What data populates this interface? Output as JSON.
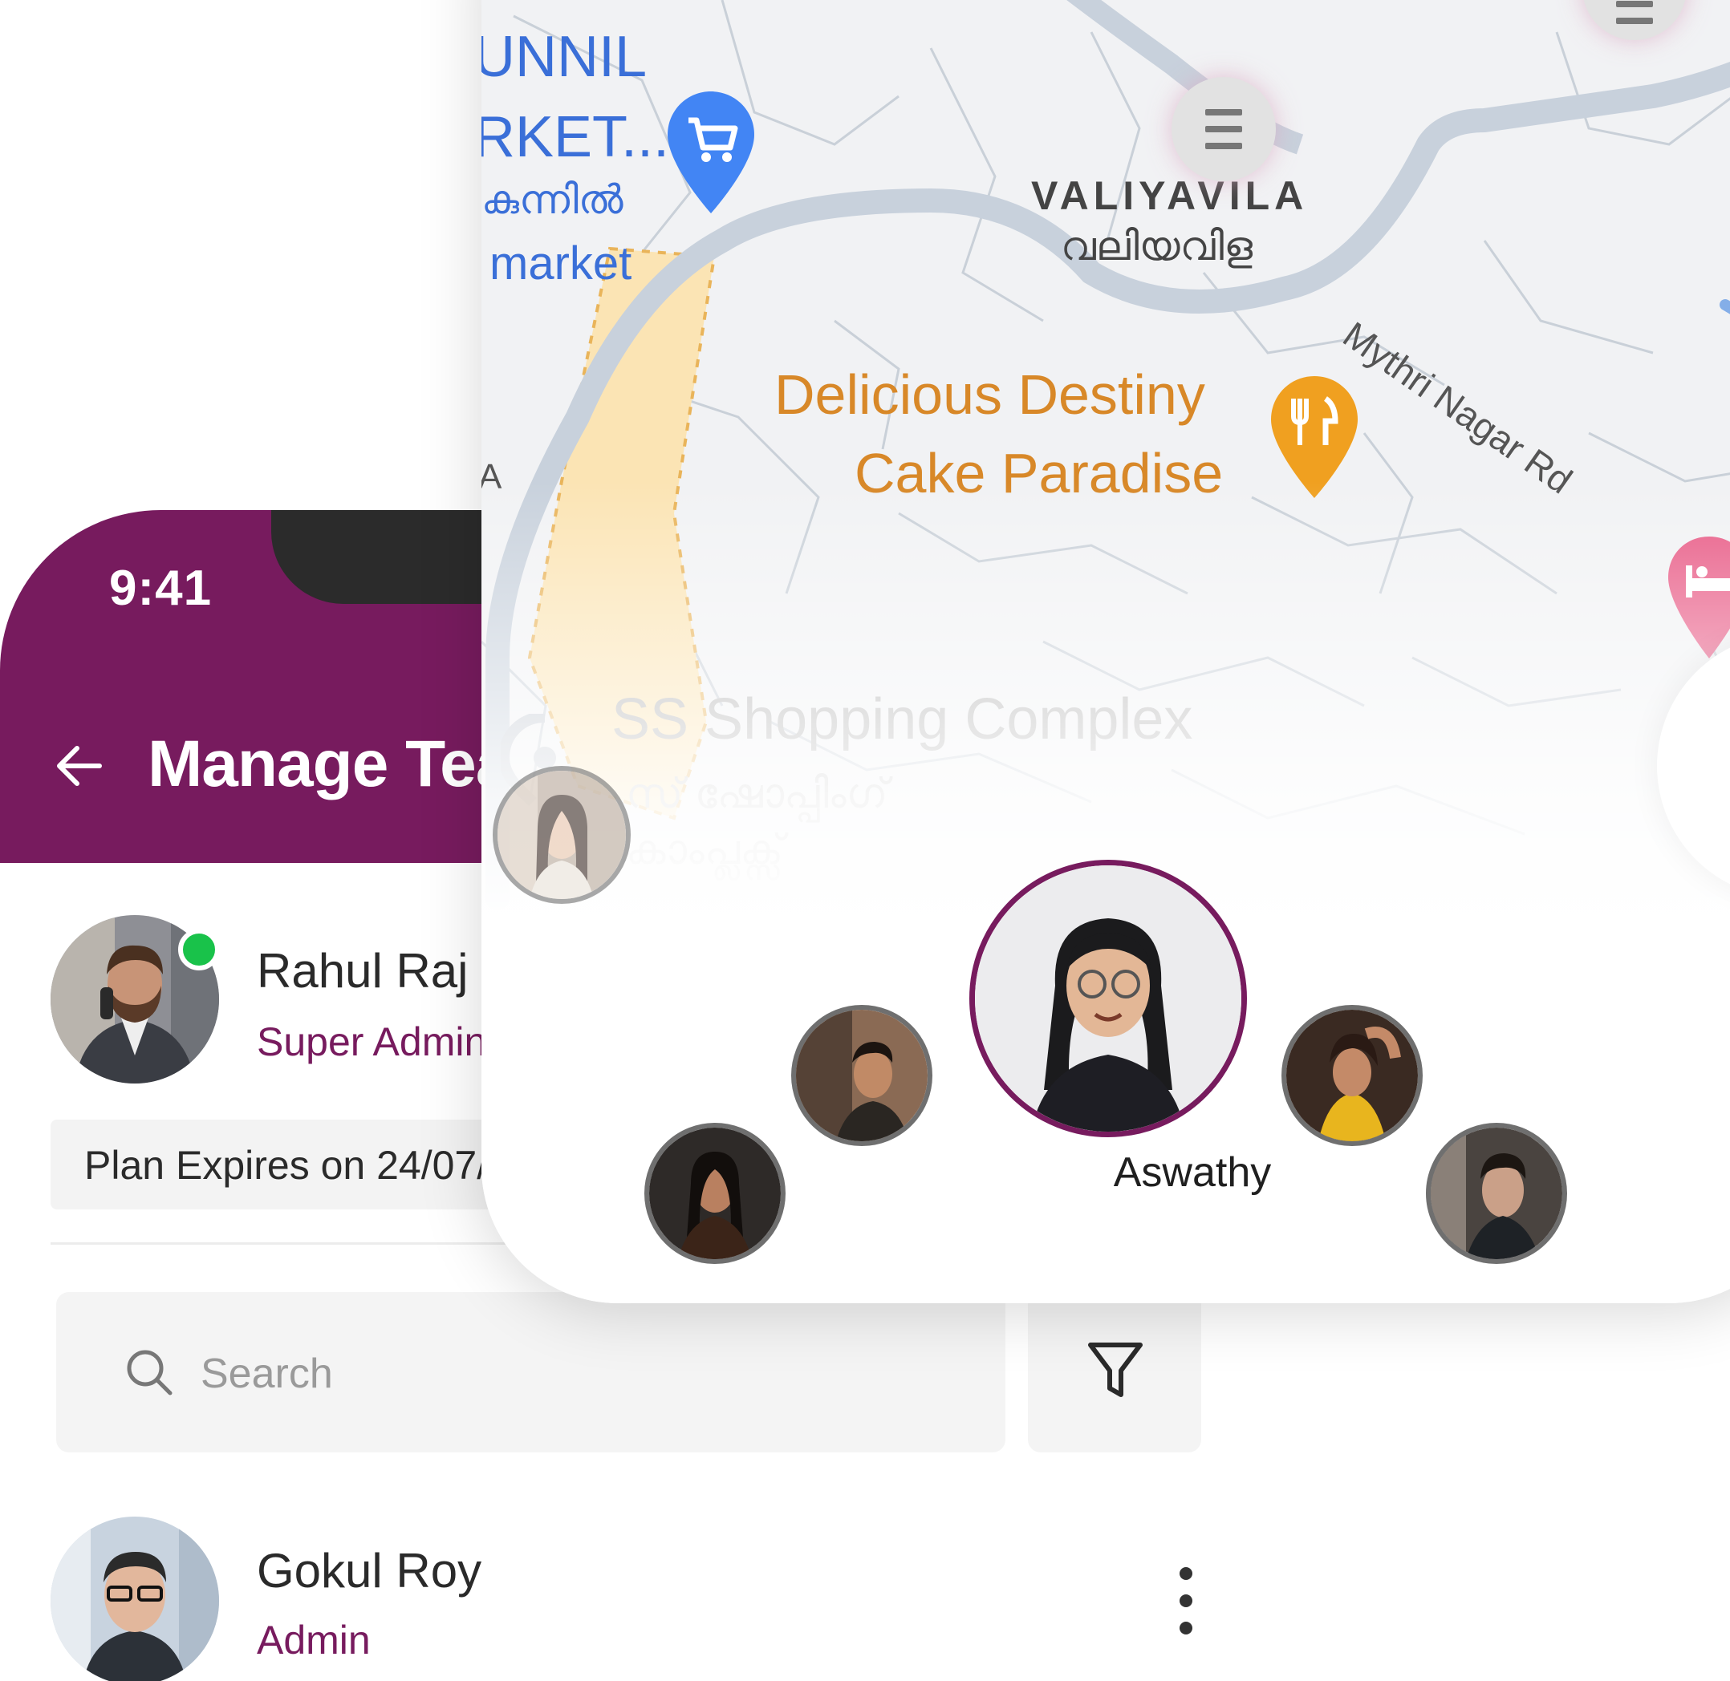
{
  "colors": {
    "brand": "#771b5e",
    "online": "#19c24a",
    "restaurant": "#f0a020",
    "shopping": "#4285f4",
    "lodging": "#e85b86"
  },
  "status_bar": {
    "time": "9:41"
  },
  "header": {
    "title": "Manage Team",
    "back_icon": "arrow-left-icon"
  },
  "current_user": {
    "name": "Rahul Raj",
    "role": "Super Admin",
    "online": true
  },
  "plan": {
    "text": "Plan Expires on 24/07/"
  },
  "search": {
    "placeholder": "Search",
    "icon": "search-icon"
  },
  "filter": {
    "icon": "filter-icon"
  },
  "members": [
    {
      "name": "Gokul Roy",
      "role": "Admin"
    }
  ],
  "map": {
    "labels": {
      "valiyavila": "VALIYAVILA",
      "valiyavila_ml": "വലിയവിള",
      "mythri_road": "Mythri Nagar Rd",
      "poi_restaurant_line1": "Delicious Destiny",
      "poi_restaurant_line2": "Cake Paradise",
      "poi_shopping": "SS Shopping Complex",
      "poi_shopping_ml_line1": "സ് ഷോപ്പിംഗ്",
      "poi_shopping_ml_line2": "കാംപ്ലക്സ്",
      "market_line1": "UNNIL",
      "market_line2": "RKET...",
      "market_line3": "കുന്നിൽ",
      "market_line4": "market",
      "edge_letter": "A"
    }
  },
  "team_selector": {
    "selected_name": "Aswathy"
  }
}
